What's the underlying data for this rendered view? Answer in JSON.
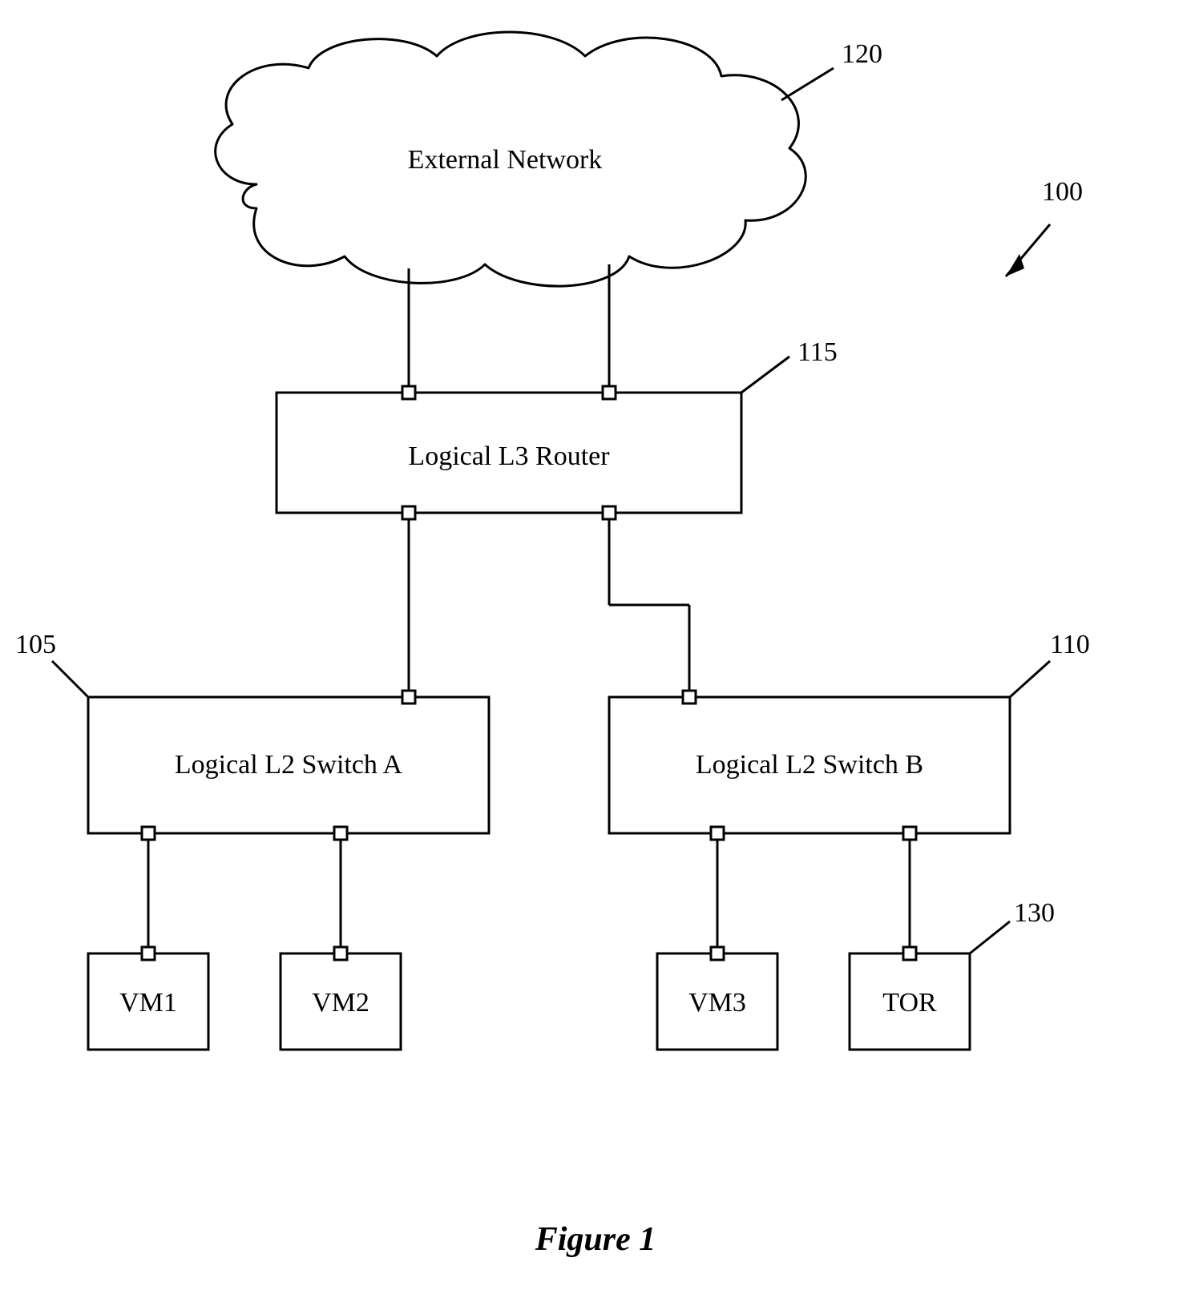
{
  "diagram": {
    "cloud_label": "External Network",
    "router_label": "Logical L3 Router",
    "switch_a_label": "Logical L2 Switch A",
    "switch_b_label": "Logical L2 Switch B",
    "vm1_label": "VM1",
    "vm2_label": "VM2",
    "vm3_label": "VM3",
    "tor_label": "TOR",
    "ref_100": "100",
    "ref_105": "105",
    "ref_110": "110",
    "ref_115": "115",
    "ref_120": "120",
    "ref_130": "130",
    "figure_caption": "Figure 1"
  }
}
